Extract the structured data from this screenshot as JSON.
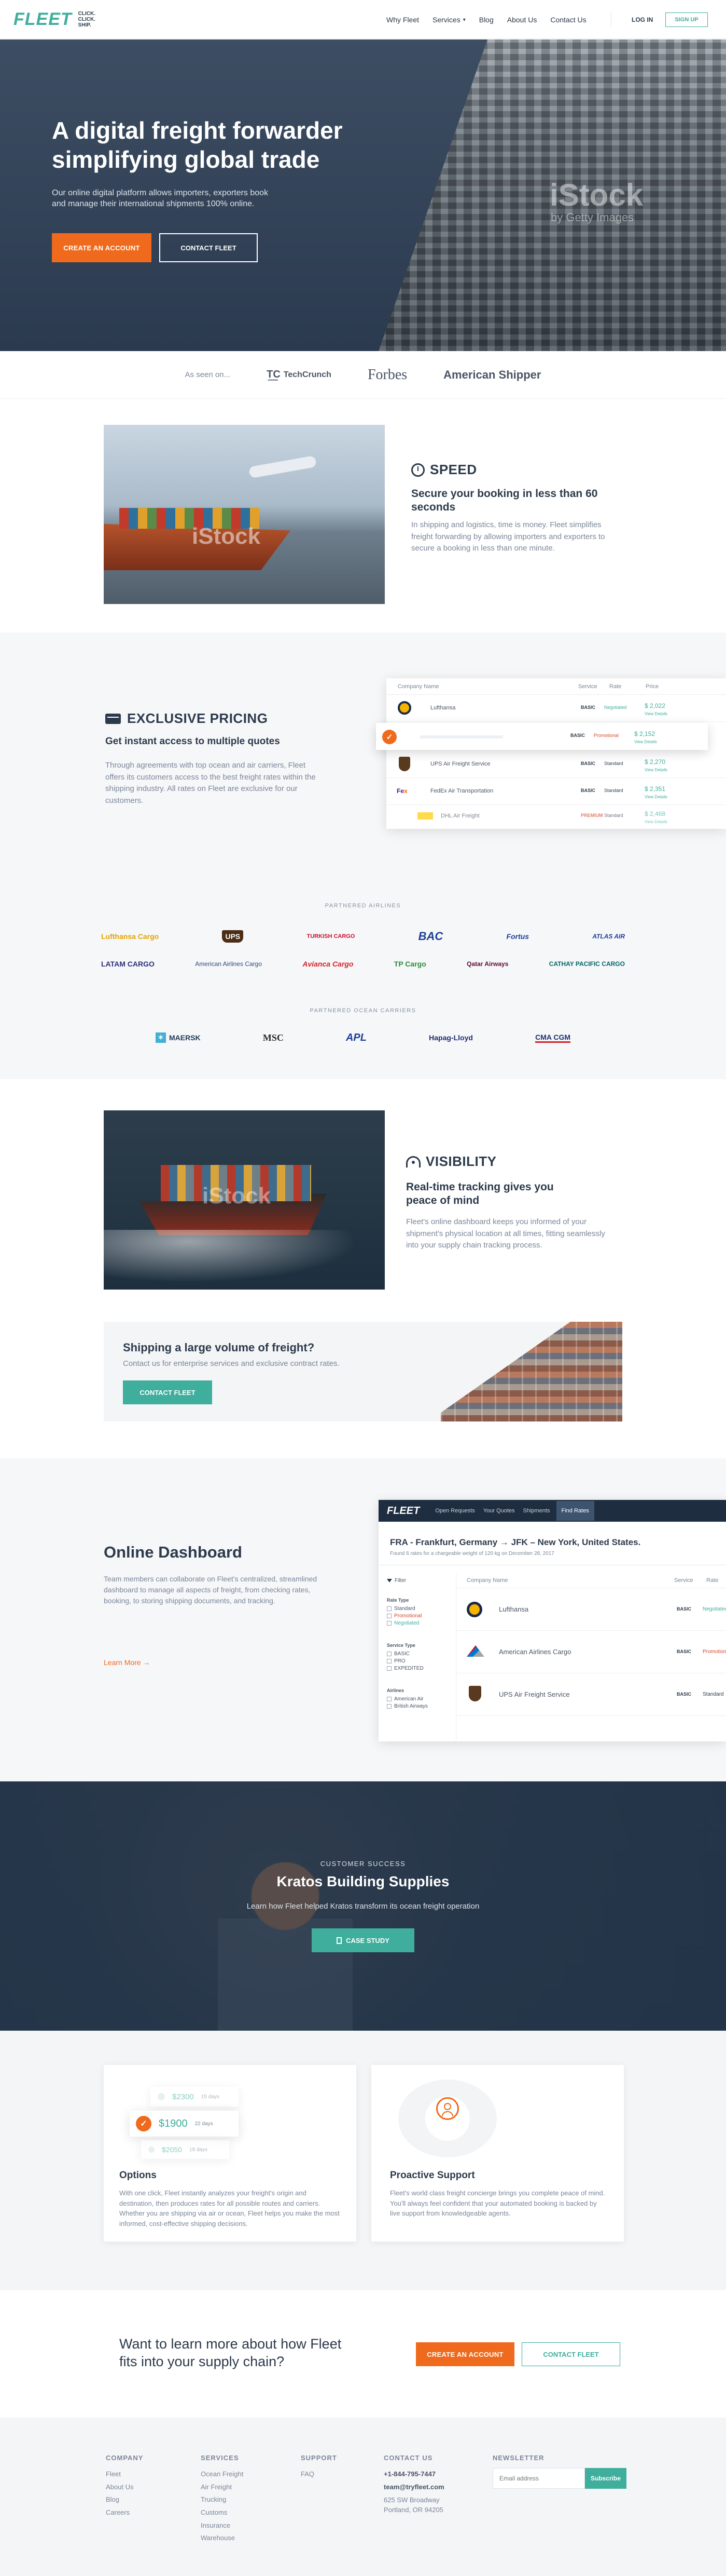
{
  "nav": {
    "logo": "FLEET",
    "tagline_lines": [
      "CLICK.",
      "CLICK.",
      "SHIP."
    ],
    "links": [
      "Why Fleet",
      "Services",
      "Blog",
      "About Us",
      "Contact Us"
    ],
    "login": "LOG IN",
    "signup": "SIGN UP"
  },
  "hero": {
    "title_line1": "A digital freight forwarder",
    "title_line2": "simplifying global trade",
    "subtitle_line1": "Our online digital platform allows importers, exporters book",
    "subtitle_line2": "and manage their international shipments 100% online.",
    "cta_primary": "CREATE AN ACCOUNT",
    "cta_secondary": "CONTACT FLEET",
    "watermark": "iStock",
    "watermark_sub": "by Getty Images"
  },
  "press": {
    "label": "As seen on...",
    "logos": [
      "TechCrunch",
      "Forbes",
      "American Shipper"
    ]
  },
  "speed": {
    "title": "SPEED",
    "subtitle": "Secure your booking in less than 60 seconds",
    "body": "In shipping and logistics, time is money. Fleet simplifies freight forwarding by allowing importers and exporters to secure a booking in less than one minute."
  },
  "pricing": {
    "title": "EXCLUSIVE PRICING",
    "subtitle": "Get instant access to multiple quotes",
    "body": "Through agreements with top ocean and air carriers, Fleet offers its customers access to the best freight rates within the shipping industry. All rates on Fleet are exclusive for our customers.",
    "table": {
      "headers": [
        "Company Name",
        "Service",
        "Rate",
        "Price"
      ],
      "rows": [
        {
          "name": "Lufthansa",
          "service": "BASIC",
          "rate": "Negotiated",
          "price": "$ 2,022",
          "link": "View Details"
        },
        {
          "name": "",
          "service": "BASIC",
          "rate": "Promotional",
          "price": "$ 2,152",
          "link": "View Details"
        },
        {
          "name": "UPS Air Freight Service",
          "service": "BASIC",
          "rate": "Standard",
          "price": "$ 2,270",
          "link": "View Details"
        },
        {
          "name": "FedEx Air Transportation",
          "service": "BASIC",
          "rate": "Standard",
          "price": "$ 2,351",
          "link": "View Details"
        },
        {
          "name": "DHL Air Freight",
          "service": "PREMIUM",
          "rate": "Standard",
          "price": "$ 2,468",
          "link": "View Details"
        }
      ]
    }
  },
  "airlines": {
    "label": "PARTNERED AIRLINES",
    "row1": [
      "Lufthansa Cargo",
      "UPS",
      "TURKISH CARGO",
      "BAC",
      "Fortus",
      "ATLAS AIR"
    ],
    "row2": [
      "LATAM CARGO",
      "American Airlines Cargo",
      "Avianca Cargo",
      "TP Cargo",
      "Qatar Airways",
      "CATHAY PACIFIC CARGO"
    ]
  },
  "ocean": {
    "label": "PARTNERED OCEAN CARRIERS",
    "logos": [
      "MAERSK",
      "MSC",
      "APL",
      "Hapag-Lloyd",
      "CMA CGM"
    ]
  },
  "visibility": {
    "title": "VISIBILITY",
    "subtitle": "Real-time tracking gives you peace of mind",
    "body": "Fleet's online dashboard keeps you informed of your shipment's physical location at all times, fitting seamlessly into your supply chain tracking process."
  },
  "volume": {
    "title": "Shipping a large volume of freight?",
    "body": "Contact us for enterprise services and exclusive contract rates.",
    "cta": "CONTACT FLEET"
  },
  "dashboard": {
    "title": "Online Dashboard",
    "body": "Team members can collaborate on Fleet's centralized, streamlined dashboard to manage all aspects of freight, from checking rates, booking, to storing shipping documents, and tracking.",
    "link": "Learn More →",
    "app": {
      "logo": "FLEET",
      "tabs": [
        "Open Requests",
        "Your Quotes",
        "Shipments",
        "Find Rates"
      ],
      "route": "FRA - Frankfurt, Germany  →  JFK – New York, United States.",
      "route_sub": "Found 6 rates for a chargeable weight of 120 kg on  December 28, 2017",
      "filters_title": "Filter",
      "filter_rate_type_label": "Rate Type",
      "filter_rate_types": [
        "Standard",
        "Promotional",
        "Negotiated"
      ],
      "filter_service_label": "Service Type",
      "filter_services": [
        "BASIC",
        "PRO",
        "EXPEDITED"
      ],
      "filter_airlines_label": "Airlines",
      "filter_airlines": [
        "American Air",
        "British Airways"
      ],
      "headers": [
        "Company Name",
        "Service",
        "Rate"
      ],
      "rows": [
        {
          "name": "Lufthansa",
          "service": "BASIC",
          "rate": "Negotiated"
        },
        {
          "name": "American Airlines Cargo",
          "service": "BASIC",
          "rate": "Promotional"
        },
        {
          "name": "UPS Air Freight Service",
          "service": "BASIC",
          "rate": "Standard"
        }
      ]
    }
  },
  "success": {
    "eyebrow": "CUSTOMER SUCCESS",
    "title": "Kratos Building Supplies",
    "body": "Learn how Fleet helped Kratos transform its ocean freight operation",
    "cta": "CASE STUDY"
  },
  "features": [
    {
      "title": "Options",
      "body": "With one click, Fleet instantly analyzes your freight's origin and destination, then produces rates for all possible routes and carriers. Whether you are shipping via air or ocean, Fleet helps you make the most informed, cost-effective shipping decisions.",
      "quotes": [
        {
          "price": "$2300",
          "days": "15 days"
        },
        {
          "price": "$1900",
          "days": "22 days"
        },
        {
          "price": "$2050",
          "days": "19 days"
        }
      ]
    },
    {
      "title": "Proactive Support",
      "body": "Fleet's world class freight concierge brings you complete peace of mind. You'll always feel confident that your automated booking is backed by live support from knowledgeable agents."
    }
  ],
  "cta_band": {
    "title_line1": "Want to learn more about how Fleet",
    "title_line2": "fits into your supply chain?",
    "primary": "CREATE AN ACCOUNT",
    "secondary": "CONTACT FLEET"
  },
  "footer": {
    "company": {
      "head": "COMPANY",
      "links": [
        "Fleet",
        "About Us",
        "Blog",
        "Careers"
      ]
    },
    "services": {
      "head": "SERVICES",
      "links": [
        "Ocean Freight",
        "Air Freight",
        "Trucking",
        "Customs",
        "Insurance",
        "Warehouse"
      ]
    },
    "support": {
      "head": "SUPPORT",
      "links": [
        "FAQ"
      ]
    },
    "contact": {
      "head": "CONTACT US",
      "phone": "+1-844-795-7447",
      "email": "team@tryfleet.com",
      "address1": "625 SW Broadway",
      "address2": "Portland, OR 94205"
    },
    "newsletter": {
      "head": "NEWSLETTER",
      "placeholder": "Email address",
      "button": "Subscribe"
    }
  },
  "colors": {
    "teal": "#3fae9d",
    "orange": "#ef6a1c",
    "navy": "#2c3a4b"
  }
}
